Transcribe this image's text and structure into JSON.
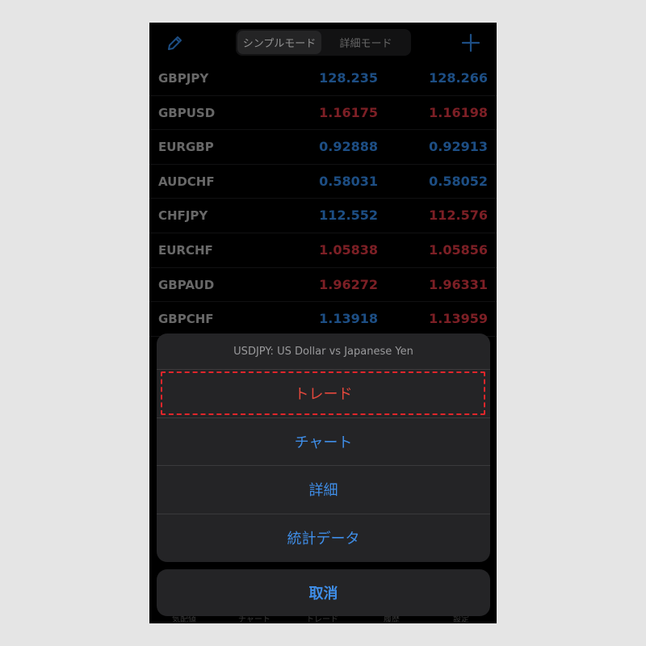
{
  "colors": {
    "blue": "#2f7fd6",
    "red": "#c8333d",
    "accent": "#3f8ee8",
    "destructive": "#e5483c",
    "highlight_border": "#e0262b"
  },
  "header": {
    "edit_icon": "pencil-icon",
    "add_icon": "plus-icon",
    "segments": [
      "シンプルモード",
      "詳細モード"
    ],
    "selected_segment": "シンプルモード"
  },
  "quotes": [
    {
      "symbol": "GBPJPY",
      "bid": "128.235",
      "ask": "128.266",
      "bid_color": "blue",
      "ask_color": "blue"
    },
    {
      "symbol": "GBPUSD",
      "bid": "1.16175",
      "ask": "1.16198",
      "bid_color": "red",
      "ask_color": "red"
    },
    {
      "symbol": "EURGBP",
      "bid": "0.92888",
      "ask": "0.92913",
      "bid_color": "blue",
      "ask_color": "blue"
    },
    {
      "symbol": "AUDCHF",
      "bid": "0.58031",
      "ask": "0.58052",
      "bid_color": "blue",
      "ask_color": "blue"
    },
    {
      "symbol": "CHFJPY",
      "bid": "112.552",
      "ask": "112.576",
      "bid_color": "blue",
      "ask_color": "red"
    },
    {
      "symbol": "EURCHF",
      "bid": "1.05838",
      "ask": "1.05856",
      "bid_color": "red",
      "ask_color": "red"
    },
    {
      "symbol": "GBPAUD",
      "bid": "1.96272",
      "ask": "1.96331",
      "bid_color": "red",
      "ask_color": "red"
    },
    {
      "symbol": "GBPCHF",
      "bid": "1.13918",
      "ask": "1.13959",
      "bid_color": "blue",
      "ask_color": "red"
    }
  ],
  "action_sheet": {
    "title": "USDJPY: US Dollar vs Japanese Yen",
    "actions": [
      "トレード",
      "チャート",
      "詳細",
      "統計データ"
    ],
    "cancel": "取消"
  },
  "tabbar": [
    "気配値",
    "チャート",
    "トレード",
    "履歴",
    "設定"
  ]
}
